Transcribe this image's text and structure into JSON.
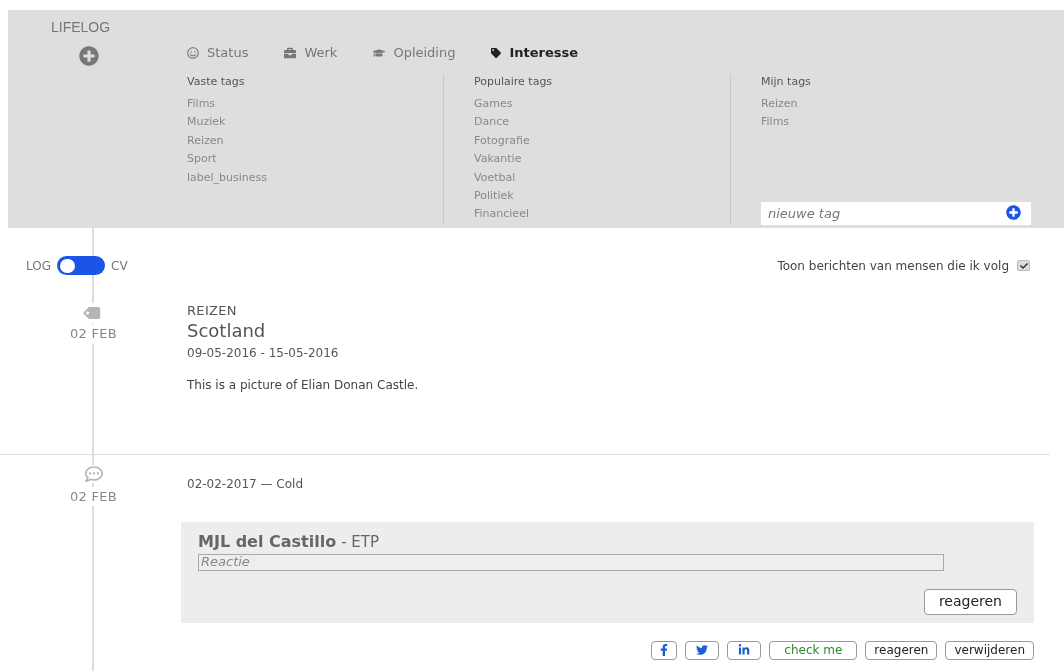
{
  "app_title": "LIFELOG",
  "tabs": [
    {
      "label": "Status",
      "selected": false
    },
    {
      "label": "Werk",
      "selected": false
    },
    {
      "label": "Opleiding",
      "selected": false
    },
    {
      "label": "Interesse",
      "selected": true
    }
  ],
  "tag_columns": [
    {
      "title": "Vaste tags",
      "tags": [
        "Films",
        "Muziek",
        "Reizen",
        "Sport",
        "label_business"
      ]
    },
    {
      "title": "Populaire tags",
      "tags": [
        "Games",
        "Dance",
        "Fotografie",
        "Vakantie",
        "Voetbal",
        "Politiek",
        "Financieel"
      ]
    },
    {
      "title": "Mijn tags",
      "tags": [
        "Reizen",
        "Films"
      ]
    }
  ],
  "new_tag": {
    "placeholder": "nieuwe tag"
  },
  "view_toggle": {
    "left_label": "LOG",
    "right_label": "CV",
    "on": false
  },
  "follow_filter": {
    "label": "Toon berichten van mensen die ik volg",
    "checked": true
  },
  "entries": [
    {
      "kind": "post",
      "date": "02 FEB",
      "category": "REIZEN",
      "title": "Scotland",
      "period": "09-05-2016 - 15-05-2016",
      "text": "This is a picture of Elian Donan Castle."
    },
    {
      "kind": "comment",
      "date": "02 FEB",
      "meta": "02-02-2017 — Cold",
      "reply": {
        "author": "MJL del Castillo",
        "org": "- ETP",
        "placeholder": "Reactie",
        "button": "reageren"
      },
      "actions": [
        "check me",
        "reageren",
        "verwijderen"
      ]
    }
  ]
}
